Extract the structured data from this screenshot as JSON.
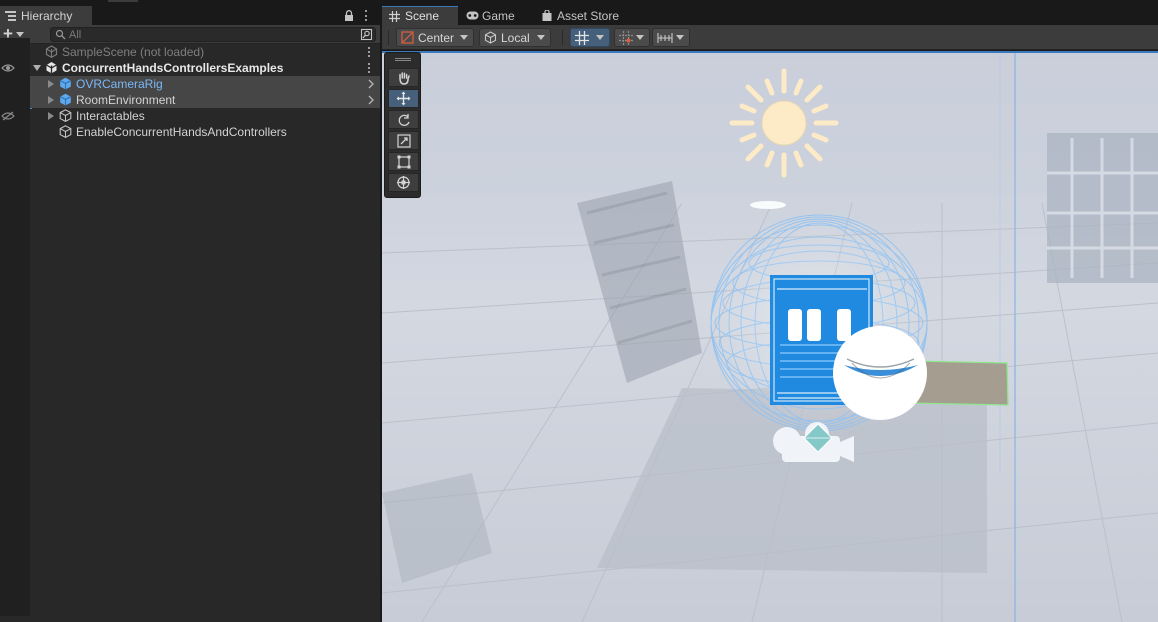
{
  "hierarchy": {
    "tab_label": "Hierarchy",
    "search_placeholder": "All",
    "rows": [
      {
        "label": "SampleScene (not loaded)"
      },
      {
        "label": "ConcurrentHandsControllersExamples"
      },
      {
        "label": "OVRCameraRig"
      },
      {
        "label": "RoomEnvironment"
      },
      {
        "label": "Interactables"
      },
      {
        "label": "EnableConcurrentHandsAndControllers"
      }
    ]
  },
  "scene": {
    "tabs": [
      {
        "label": "Scene"
      },
      {
        "label": "Game"
      },
      {
        "label": "Asset Store"
      }
    ],
    "pivot_mode": "Center",
    "pivot_rotation": "Local"
  },
  "colors": {
    "accent": "#3a79bb",
    "prefab_blue": "#6aaef0",
    "panel": "#282828",
    "toolbar": "#3c3c3c"
  },
  "icons": {
    "tools": [
      "hand-tool-icon",
      "move-tool-icon",
      "rotate-tool-icon",
      "scale-tool-icon",
      "rect-tool-icon",
      "transform-tool-icon"
    ]
  }
}
